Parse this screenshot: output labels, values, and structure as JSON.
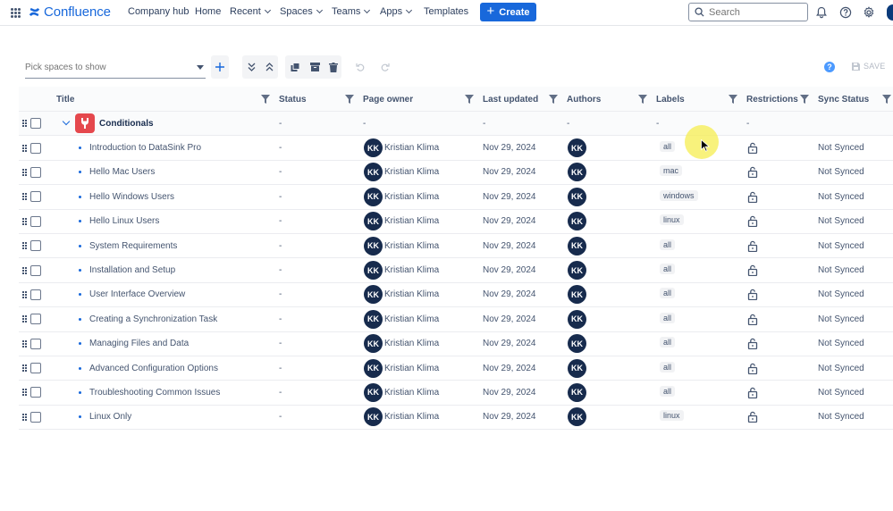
{
  "nav": {
    "brand": "Confluence",
    "items": [
      {
        "label": "Company hub",
        "dropdown": false
      },
      {
        "label": "Home",
        "dropdown": false
      },
      {
        "label": "Recent",
        "dropdown": true
      },
      {
        "label": "Spaces",
        "dropdown": true
      },
      {
        "label": "Teams",
        "dropdown": true
      },
      {
        "label": "Apps",
        "dropdown": true
      },
      {
        "label": "Templates",
        "dropdown": false
      }
    ],
    "create_label": "Create",
    "search_placeholder": "Search",
    "icons": [
      "notifications-icon",
      "help-icon",
      "settings-icon",
      "profile-icon"
    ]
  },
  "toolbar": {
    "space_picker_placeholder": "Pick spaces to show",
    "save_label": "SAVE",
    "help_glyph": "?"
  },
  "columns": [
    "Title",
    "Status",
    "Page owner",
    "Last updated",
    "Authors",
    "Labels",
    "Restrictions",
    "Sync Status"
  ],
  "group": {
    "title": "Conditionals",
    "status": "-",
    "owner": "-",
    "updated": "-",
    "authors": "-",
    "labels": "-",
    "restrictions": "-"
  },
  "rows": [
    {
      "title": "Introduction to DataSink Pro",
      "status": "-",
      "owner_initials": "KK",
      "owner": "Kristian Klima",
      "updated": "Nov 29, 2024",
      "author_initials": "KK",
      "label": "all",
      "sync": "Not Synced"
    },
    {
      "title": "Hello Mac Users",
      "status": "-",
      "owner_initials": "KK",
      "owner": "Kristian Klima",
      "updated": "Nov 29, 2024",
      "author_initials": "KK",
      "label": "mac",
      "sync": "Not Synced"
    },
    {
      "title": "Hello Windows Users",
      "status": "-",
      "owner_initials": "KK",
      "owner": "Kristian Klima",
      "updated": "Nov 29, 2024",
      "author_initials": "KK",
      "label": "windows",
      "sync": "Not Synced"
    },
    {
      "title": "Hello Linux Users",
      "status": "-",
      "owner_initials": "KK",
      "owner": "Kristian Klima",
      "updated": "Nov 29, 2024",
      "author_initials": "KK",
      "label": "linux",
      "sync": "Not Synced"
    },
    {
      "title": "System Requirements",
      "status": "-",
      "owner_initials": "KK",
      "owner": "Kristian Klima",
      "updated": "Nov 29, 2024",
      "author_initials": "KK",
      "label": "all",
      "sync": "Not Synced"
    },
    {
      "title": "Installation and Setup",
      "status": "-",
      "owner_initials": "KK",
      "owner": "Kristian Klima",
      "updated": "Nov 29, 2024",
      "author_initials": "KK",
      "label": "all",
      "sync": "Not Synced"
    },
    {
      "title": "User Interface Overview",
      "status": "-",
      "owner_initials": "KK",
      "owner": "Kristian Klima",
      "updated": "Nov 29, 2024",
      "author_initials": "KK",
      "label": "all",
      "sync": "Not Synced"
    },
    {
      "title": "Creating a Synchronization Task",
      "status": "-",
      "owner_initials": "KK",
      "owner": "Kristian Klima",
      "updated": "Nov 29, 2024",
      "author_initials": "KK",
      "label": "all",
      "sync": "Not Synced"
    },
    {
      "title": "Managing Files and Data",
      "status": "-",
      "owner_initials": "KK",
      "owner": "Kristian Klima",
      "updated": "Nov 29, 2024",
      "author_initials": "KK",
      "label": "all",
      "sync": "Not Synced"
    },
    {
      "title": "Advanced Configuration Options",
      "status": "-",
      "owner_initials": "KK",
      "owner": "Kristian Klima",
      "updated": "Nov 29, 2024",
      "author_initials": "KK",
      "label": "all",
      "sync": "Not Synced"
    },
    {
      "title": "Troubleshooting Common Issues",
      "status": "-",
      "owner_initials": "KK",
      "owner": "Kristian Klima",
      "updated": "Nov 29, 2024",
      "author_initials": "KK",
      "label": "all",
      "sync": "Not Synced"
    },
    {
      "title": "Linux Only",
      "status": "-",
      "owner_initials": "KK",
      "owner": "Kristian Klima",
      "updated": "Nov 29, 2024",
      "author_initials": "KK",
      "label": "linux",
      "sync": "Not Synced"
    }
  ],
  "colors": {
    "brand": "#1868db",
    "avatar_bg": "#172b4d",
    "space_icon_bg": "#e5484d",
    "cursor_highlight": "#f6ee50"
  }
}
